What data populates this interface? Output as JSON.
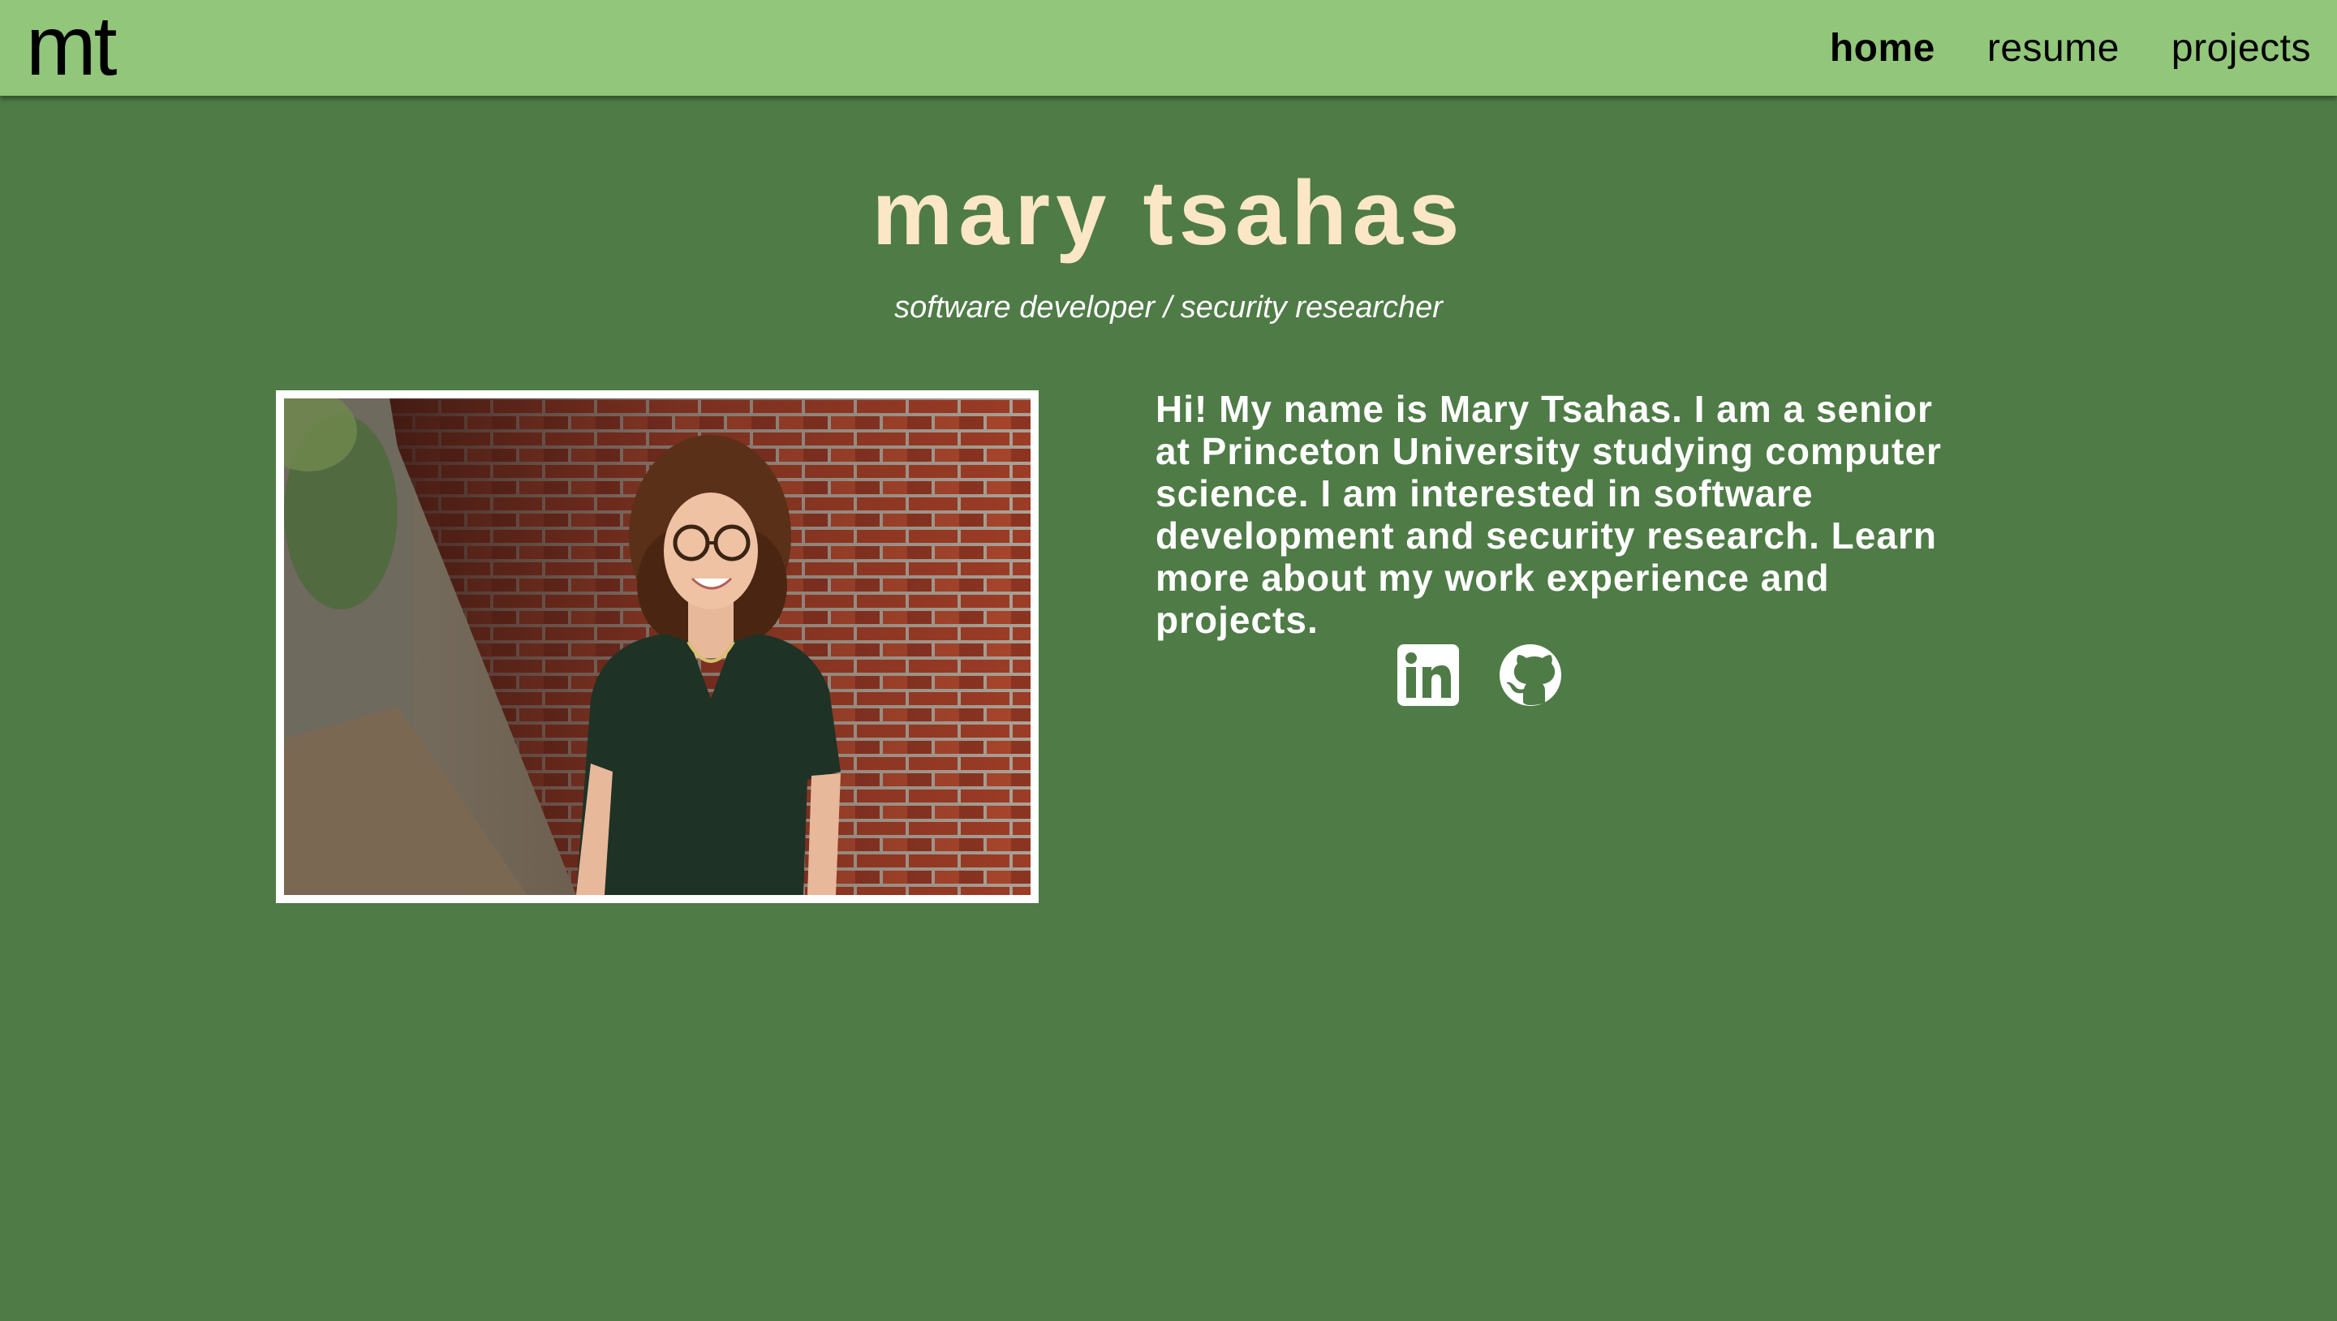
{
  "header": {
    "logo": "mt",
    "nav": [
      {
        "label": "home",
        "active": true
      },
      {
        "label": "resume",
        "active": false
      },
      {
        "label": "projects",
        "active": false
      }
    ]
  },
  "hero": {
    "name": "mary tsahas",
    "subtitle": "software developer / security researcher"
  },
  "about": {
    "bio": "Hi! My name is Mary Tsahas. I am a senior at Princeton University studying computer science. I am interested in software development and security research. Learn more about my work experience and projects."
  },
  "social": [
    {
      "icon": "linkedin-icon"
    },
    {
      "icon": "github-icon"
    }
  ],
  "colors": {
    "header_bg": "#92c67a",
    "page_bg": "#4e7b46",
    "title": "#fbe7c6",
    "text": "#ffffff"
  }
}
